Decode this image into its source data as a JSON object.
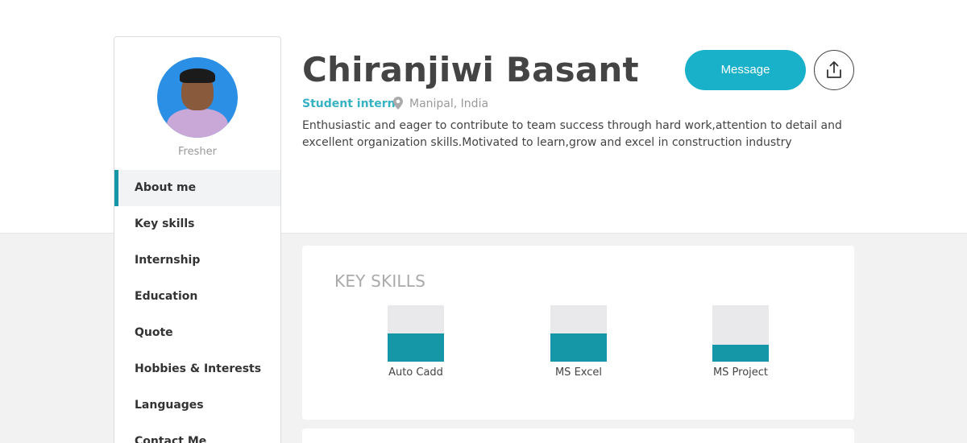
{
  "profile": {
    "name": "Chiranjiwi Basant",
    "role": "Student intern",
    "location": "Manipal, India",
    "status": "Fresher",
    "bio": "Enthusiastic and eager to contribute to team success through hard work,attention to detail and excellent organization skills.Motivated to learn,grow and excel in construction industry"
  },
  "actions": {
    "message_label": "Message",
    "share_icon": "share-icon"
  },
  "sidebar": {
    "items": [
      {
        "label": "About me",
        "active": true
      },
      {
        "label": "Key skills"
      },
      {
        "label": "Internship"
      },
      {
        "label": "Education"
      },
      {
        "label": "Quote"
      },
      {
        "label": "Hobbies & Interests"
      },
      {
        "label": "Languages"
      },
      {
        "label": "Contact Me"
      }
    ]
  },
  "skills": {
    "title": "KEY SKILLS",
    "items": [
      {
        "name": "Auto Cadd",
        "level": 0.5
      },
      {
        "name": "MS Excel",
        "level": 0.5
      },
      {
        "name": "MS Project",
        "level": 0.3
      }
    ]
  },
  "colors": {
    "accent": "#18b1c9",
    "skill_fill": "#1597a8",
    "role_text": "#36b2c5"
  }
}
